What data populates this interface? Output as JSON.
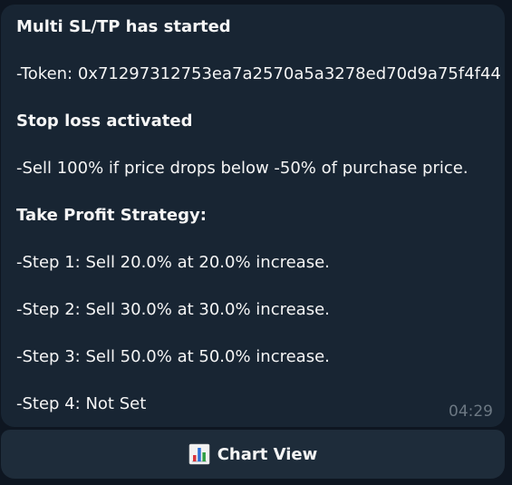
{
  "message": {
    "title": "Multi SL/TP has started",
    "token": "-Token: 0x71297312753ea7a2570a5a3278ed70d9a75f4f44",
    "stop_loss_heading": "Stop loss activated",
    "stop_loss_text": "-Sell 100% if price drops below -50% of purchase price.",
    "take_profit_heading": "Take Profit Strategy:",
    "steps": [
      "-Step 1: Sell 20.0% at 20.0% increase.",
      "-Step 2: Sell 30.0% at 30.0% increase.",
      "-Step 3: Sell 50.0% at 50.0% increase.",
      "-Step 4: Not Set"
    ],
    "time": "04:29"
  },
  "button": {
    "label": "Chart View",
    "icon": "bar-chart-icon"
  },
  "colors": {
    "background": "#0e1621",
    "bubble": "#182533",
    "button": "#1e2c3a",
    "text": "#f5f5f5",
    "time": "#6c7883"
  }
}
